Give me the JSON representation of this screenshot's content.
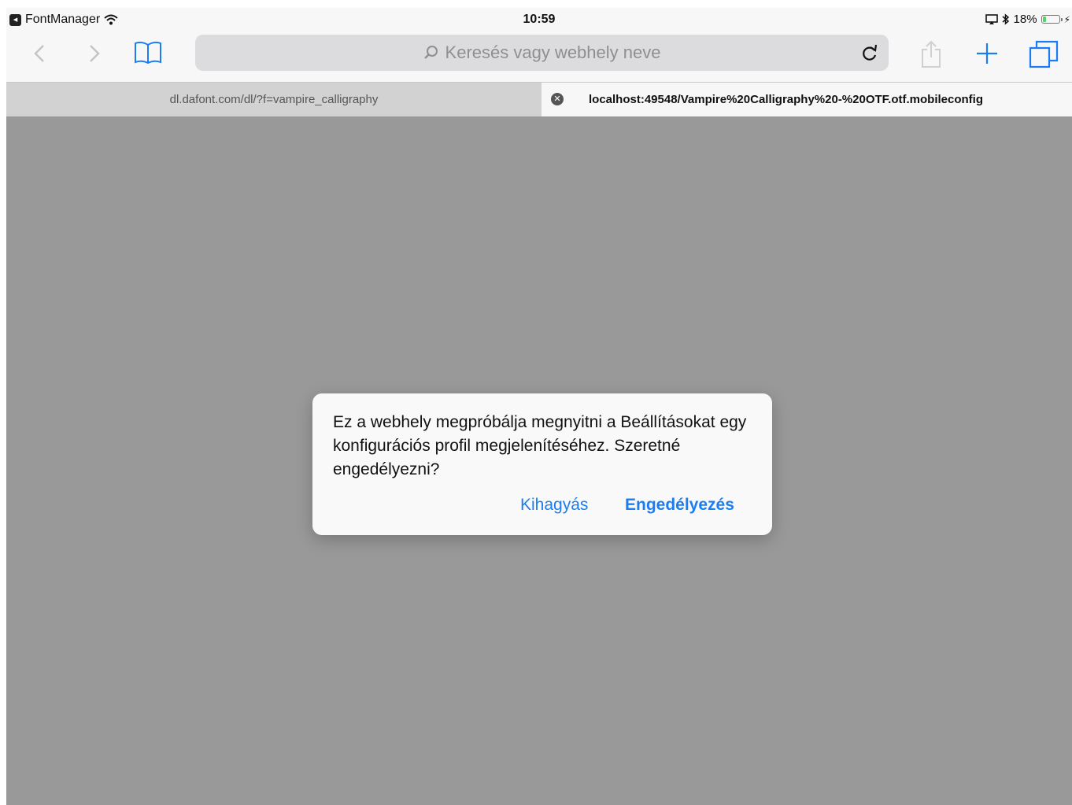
{
  "status_bar": {
    "back_app": "FontManager",
    "time": "10:59",
    "battery_percent": "18%",
    "battery_level": 0.18
  },
  "toolbar": {
    "search_placeholder": "Keresés vagy webhely neve"
  },
  "tabs": [
    {
      "title": "dl.dafont.com/dl/?f=vampire_calligraphy",
      "active": false
    },
    {
      "title": "localhost:49548/Vampire%20Calligraphy%20-%20OTF.otf.mobileconfig",
      "active": true
    }
  ],
  "dialog": {
    "message": "Ez a webhely megpróbálja megnyitni a Beállításokat egy konfigurációs profil megjelenítéséhez. Szeretné engedélyezni?",
    "skip_label": "Kihagyás",
    "allow_label": "Engedélyezés"
  },
  "colors": {
    "accent": "#1a7ef2",
    "overlay": "#999999",
    "battery": "#4cd964"
  }
}
